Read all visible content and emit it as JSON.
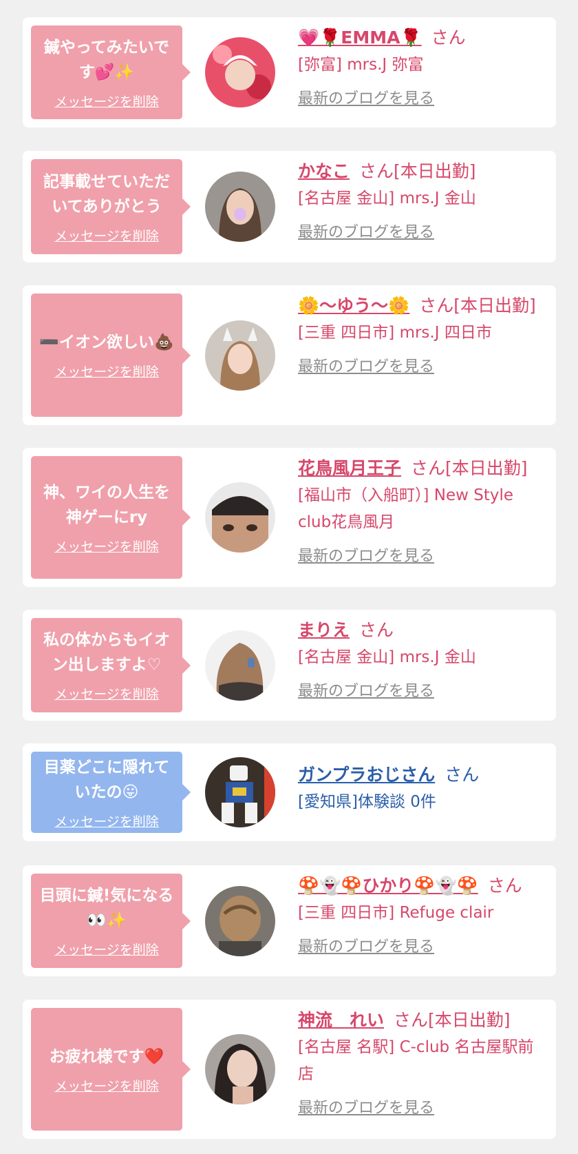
{
  "theme": {
    "pink": "#f0a0ab",
    "blue": "#93b6ee",
    "accent_text": "#d6476a",
    "blue_text": "#2a5ea8",
    "muted_text": "#8c8c8c"
  },
  "cards": [
    {
      "message": "鍼やってみたいです💕✨",
      "delete_label": "メッセージを削除",
      "name": "💗🌹EMMA🌹",
      "suffix": "さん",
      "shop": "[弥富] mrs.J 弥富",
      "blog_link": "最新のブログを見る",
      "bubble_color": "pink"
    },
    {
      "message": "記事載せていただいてありがとう",
      "delete_label": "メッセージを削除",
      "name": "かなこ",
      "suffix": "さん[本日出勤]",
      "shop": "[名古屋 金山] mrs.J 金山",
      "blog_link": "最新のブログを見る",
      "bubble_color": "pink"
    },
    {
      "message": "➖イオン欲しい💩",
      "delete_label": "メッセージを削除",
      "name": "🌼〜ゆう〜🌼",
      "suffix": "さん[本日出勤]",
      "shop": "[三重 四日市] mrs.J 四日市",
      "blog_link": "最新のブログを見る",
      "bubble_color": "pink"
    },
    {
      "message": "神、ワイの人生を神ゲーにry",
      "delete_label": "メッセージを削除",
      "name": "花鳥風月王子",
      "suffix": "さん[本日出勤]",
      "shop": "[福山市（入船町）] New Style club花鳥風月",
      "blog_link": "最新のブログを見る",
      "bubble_color": "pink"
    },
    {
      "message": "私の体からもイオン出しますよ♡",
      "delete_label": "メッセージを削除",
      "name": "まりえ",
      "suffix": "さん",
      "shop": "[名古屋 金山] mrs.J 金山",
      "blog_link": "最新のブログを見る",
      "bubble_color": "pink"
    },
    {
      "message": "目薬どこに隠れていたの😛",
      "delete_label": "メッセージを削除",
      "name": "ガンプラおじさん",
      "suffix": "さん",
      "shop": "[愛知県]体験談 0件",
      "bubble_color": "blue"
    },
    {
      "message": "目頭に鍼!気になる👀✨",
      "delete_label": "メッセージを削除",
      "name": "🍄👻🍄ひかり🍄👻🍄",
      "suffix": "さん",
      "shop": "[三重 四日市] Refuge clair",
      "blog_link": "最新のブログを見る",
      "bubble_color": "pink"
    },
    {
      "message": "お疲れ様です❤️",
      "delete_label": "メッセージを削除",
      "name": "神流　れい",
      "suffix": "さん[本日出勤]",
      "shop": "[名古屋 名駅] C-club 名古屋駅前店",
      "blog_link": "最新のブログを見る",
      "bubble_color": "pink"
    }
  ]
}
